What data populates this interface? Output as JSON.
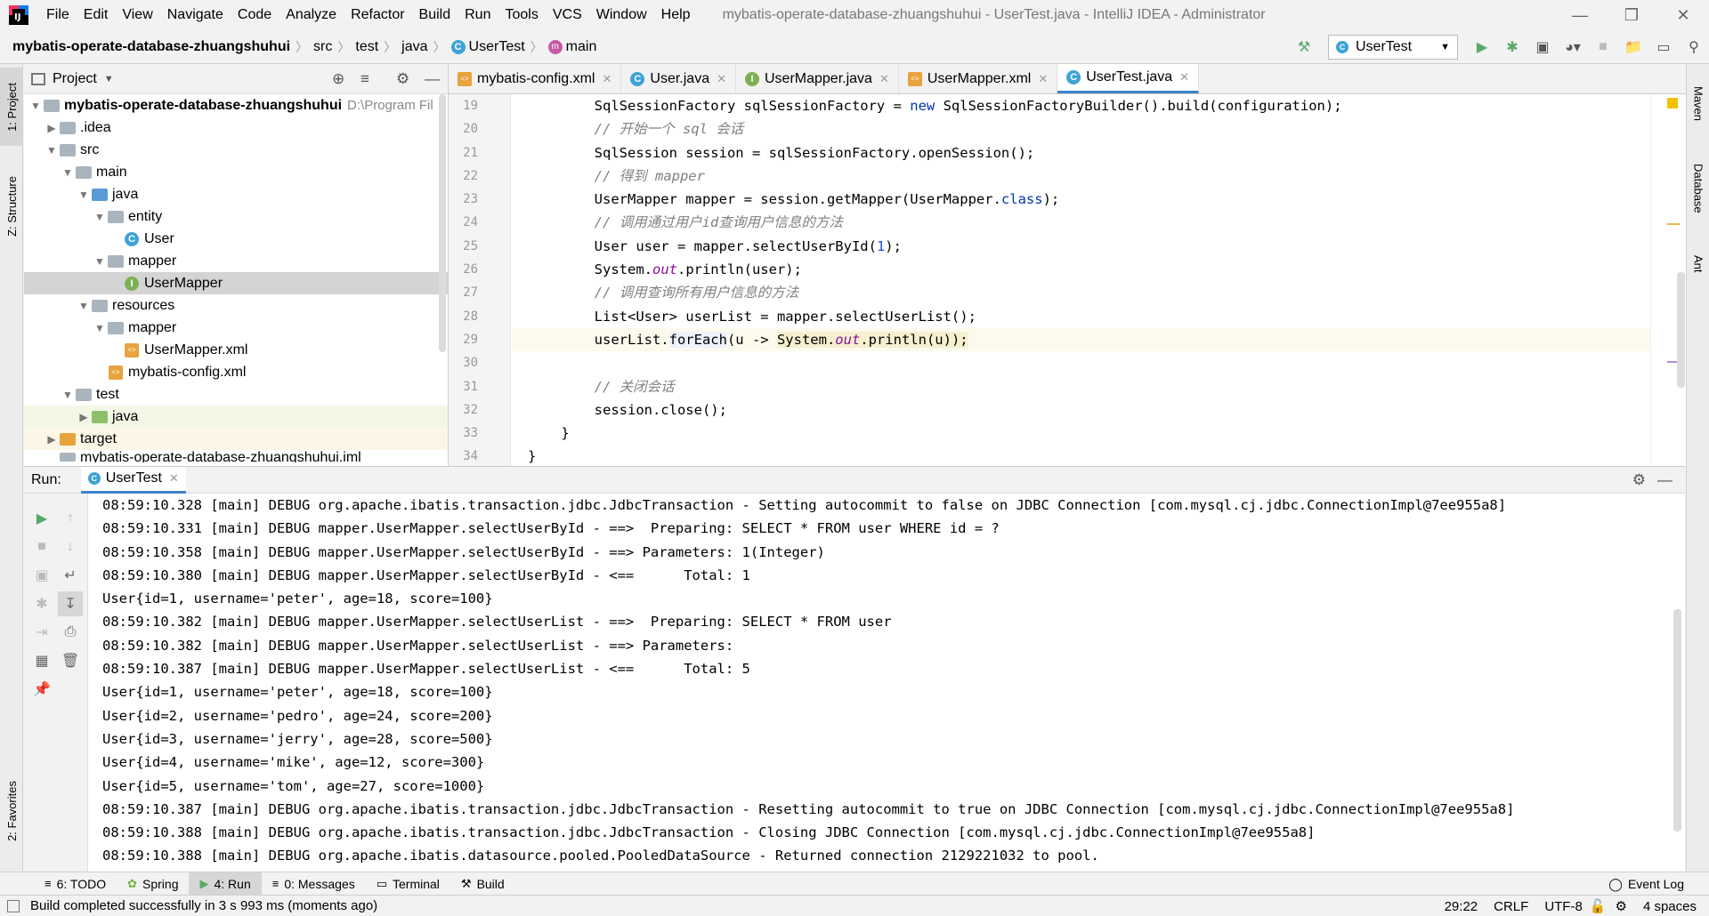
{
  "menubar": {
    "items": [
      "File",
      "Edit",
      "View",
      "Navigate",
      "Code",
      "Analyze",
      "Refactor",
      "Build",
      "Run",
      "Tools",
      "VCS",
      "Window",
      "Help"
    ],
    "window_title": "mybatis-operate-database-zhuangshuhui - UserTest.java - IntelliJ IDEA - Administrator"
  },
  "breadcrumb": {
    "project": "mybatis-operate-database-zhuangshuhui",
    "src": "src",
    "test": "test",
    "java": "java",
    "class": "UserTest",
    "method": "main"
  },
  "run_config": {
    "label": "UserTest"
  },
  "left_stripe": {
    "project": "1: Project",
    "structure": "Z: Structure",
    "favorites": "2: Favorites"
  },
  "right_stripe": {
    "maven": "Maven",
    "database": "Database",
    "ant": "Ant"
  },
  "project_panel": {
    "title": "Project",
    "tree": [
      {
        "label": "mybatis-operate-database-zhuangshuhui",
        "hint": "D:\\Program Fil"
      },
      {
        "label": ".idea"
      },
      {
        "label": "src"
      },
      {
        "label": "main"
      },
      {
        "label": "java"
      },
      {
        "label": "entity"
      },
      {
        "label": "User"
      },
      {
        "label": "mapper"
      },
      {
        "label": "UserMapper"
      },
      {
        "label": "resources"
      },
      {
        "label": "mapper"
      },
      {
        "label": "UserMapper.xml"
      },
      {
        "label": "mybatis-config.xml"
      },
      {
        "label": "test"
      },
      {
        "label": "java"
      },
      {
        "label": "target"
      },
      {
        "label": "mybatis-operate-database-zhuangshuhui.iml"
      }
    ]
  },
  "editor": {
    "tabs": [
      "mybatis-config.xml",
      "User.java",
      "UserMapper.java",
      "UserMapper.xml",
      "UserTest.java"
    ],
    "line_numbers": [
      "19",
      "20",
      "21",
      "22",
      "23",
      "24",
      "25",
      "26",
      "27",
      "28",
      "29",
      "30",
      "31",
      "32",
      "33",
      "34"
    ],
    "code": {
      "l19a": "        SqlSessionFactory sqlSessionFactory = ",
      "l19kw": "new",
      "l19b": " SqlSessionFactoryBuilder().build(configuration);",
      "l20": "        // 开始一个 sql 会话",
      "l21": "        SqlSession session = sqlSessionFactory.openSession();",
      "l22": "        // 得到 mapper",
      "l23a": "        UserMapper mapper = session.getMapper(UserMapper.",
      "l23kw": "class",
      "l23b": ");",
      "l24": "        // 调用通过用户id查询用户信息的方法",
      "l25a": "        User user = mapper.selectUserById(",
      "l25num": "1",
      "l25b": ");",
      "l26a": "        System.",
      "l26st": "out",
      "l26b": ".println(user);",
      "l27": "        // 调用查询所有用户信息的方法",
      "l28": "        List<User> userList = mapper.selectUserList();",
      "l29a": "        userList.",
      "l29hl": "forEach",
      "l29b": "(u -> ",
      "l29c": "System.",
      "l29st": "out",
      "l29d": ".println(u));",
      "l30": "",
      "l31": "        // 关闭会话",
      "l32": "        session.close();",
      "l33": "    }",
      "l34": "}"
    }
  },
  "run_panel": {
    "label": "Run:",
    "tab": "UserTest",
    "lines": [
      "08:59:10.328 [main] DEBUG org.apache.ibatis.transaction.jdbc.JdbcTransaction - Setting autocommit to false on JDBC Connection [com.mysql.cj.jdbc.ConnectionImpl@7ee955a8]",
      "08:59:10.331 [main] DEBUG mapper.UserMapper.selectUserById - ==>  Preparing: SELECT * FROM user WHERE id = ?",
      "08:59:10.358 [main] DEBUG mapper.UserMapper.selectUserById - ==> Parameters: 1(Integer)",
      "08:59:10.380 [main] DEBUG mapper.UserMapper.selectUserById - <==      Total: 1",
      "User{id=1, username='peter', age=18, score=100}",
      "08:59:10.382 [main] DEBUG mapper.UserMapper.selectUserList - ==>  Preparing: SELECT * FROM user",
      "08:59:10.382 [main] DEBUG mapper.UserMapper.selectUserList - ==> Parameters: ",
      "08:59:10.387 [main] DEBUG mapper.UserMapper.selectUserList - <==      Total: 5",
      "User{id=1, username='peter', age=18, score=100}",
      "User{id=2, username='pedro', age=24, score=200}",
      "User{id=3, username='jerry', age=28, score=500}",
      "User{id=4, username='mike', age=12, score=300}",
      "User{id=5, username='tom', age=27, score=1000}",
      "08:59:10.387 [main] DEBUG org.apache.ibatis.transaction.jdbc.JdbcTransaction - Resetting autocommit to true on JDBC Connection [com.mysql.cj.jdbc.ConnectionImpl@7ee955a8]",
      "08:59:10.388 [main] DEBUG org.apache.ibatis.transaction.jdbc.JdbcTransaction - Closing JDBC Connection [com.mysql.cj.jdbc.ConnectionImpl@7ee955a8]",
      "08:59:10.388 [main] DEBUG org.apache.ibatis.datasource.pooled.PooledDataSource - Returned connection 2129221032 to pool."
    ]
  },
  "tool_windows": {
    "todo": "6: TODO",
    "spring": "Spring",
    "run": "4: Run",
    "messages": "0: Messages",
    "terminal": "Terminal",
    "build": "Build",
    "event_log": "Event Log"
  },
  "status": {
    "message": "Build completed successfully in 3 s 993 ms (moments ago)",
    "position": "29:22",
    "line_sep": "CRLF",
    "encoding": "UTF-8",
    "indent": "4 spaces"
  },
  "colors": {
    "accent": "#4083c9",
    "run_green": "#59a869",
    "comment": "#808080",
    "keyword": "#0033b3"
  }
}
